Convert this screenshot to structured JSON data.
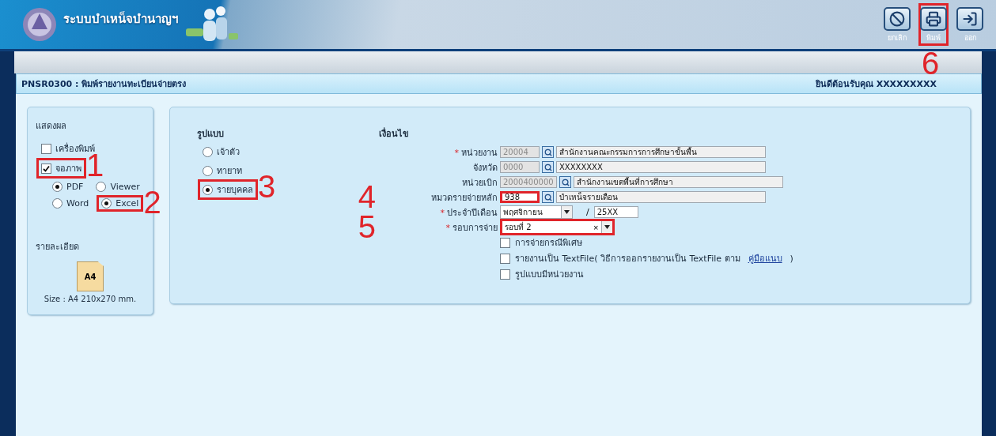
{
  "header": {
    "title": "ระบบบำเหน็จบำนาญฯ",
    "buttons": [
      {
        "kind": "cancel",
        "label": "ยกเลิก"
      },
      {
        "kind": "print",
        "label": "พิมพ์",
        "callout": "6"
      },
      {
        "kind": "exit",
        "label": "ออก"
      }
    ]
  },
  "page_bar": {
    "title": "PNSR0300 : พิมพ์รายงานทะเบียนจ่ายตรง",
    "welcome": "ยินดีต้อนรับคุณ XXXXXXXXX"
  },
  "display": {
    "heading": "แสดงผล",
    "outputs": [
      {
        "label": "เครื่องพิมพ์",
        "checked": false
      },
      {
        "label": "จอภาพ",
        "checked": true,
        "callout": "1"
      }
    ],
    "formats": [
      {
        "label": "PDF",
        "selected": true
      },
      {
        "label": "Viewer",
        "selected": false
      },
      {
        "label": "Word",
        "selected": false
      },
      {
        "label": "Excel",
        "selected": true,
        "callout": "2"
      }
    ]
  },
  "details": {
    "heading": "รายละเอียด",
    "paper": "A4",
    "size": "Size : A4 210x270 mm."
  },
  "format": {
    "heading": "รูปแบบ",
    "options": [
      {
        "label": "เจ้าตัว",
        "selected": false
      },
      {
        "label": "ทายาท",
        "selected": false
      },
      {
        "label": "รายบุคคล",
        "selected": true,
        "callout": "3"
      }
    ]
  },
  "conditions": {
    "heading": "เงื่อนไข",
    "fields": [
      {
        "kind": "lookup",
        "label": "หน่วยงาน",
        "required_mark": "*",
        "code": "20004",
        "disabled": true,
        "name": "สำนักงานคณะกรรมการการศึกษาขั้นพื้น"
      },
      {
        "kind": "lookup",
        "label": "จังหวัด",
        "code": "0000",
        "disabled": true,
        "name": "XXXXXXXX"
      },
      {
        "kind": "lookup",
        "label": "หน่วยเบิก",
        "code": "2000400000",
        "disabled": true,
        "name": "สำนักงานเขตพื้นที่การศึกษา"
      },
      {
        "kind": "lookup",
        "label": "หมวดรายจ่ายหลัก",
        "code": "938",
        "disabled": false,
        "name": "บำเหน็จรายเดือน",
        "callout": "4"
      },
      {
        "kind": "period",
        "label": "ประจำปีเดือน",
        "required_mark": "*",
        "month": "พฤศจิกายน",
        "separator": "/",
        "year": "25XX"
      },
      {
        "kind": "combo",
        "label": "รอบการจ่าย",
        "required_mark": "*",
        "value": "รอบที่ 2",
        "clear": "×",
        "callout": "5"
      }
    ],
    "options": [
      {
        "label": "การจ่ายกรณีพิเศษ",
        "checked": false
      },
      {
        "label": "รายงานเป็น TextFile( วิธีการออกรายงานเป็น TextFile ตาม",
        "link": "คู่มือแนบ",
        "suffix": ")",
        "checked": false
      },
      {
        "label": "รูปแบบมีหน่วยงาน",
        "checked": false
      }
    ]
  }
}
